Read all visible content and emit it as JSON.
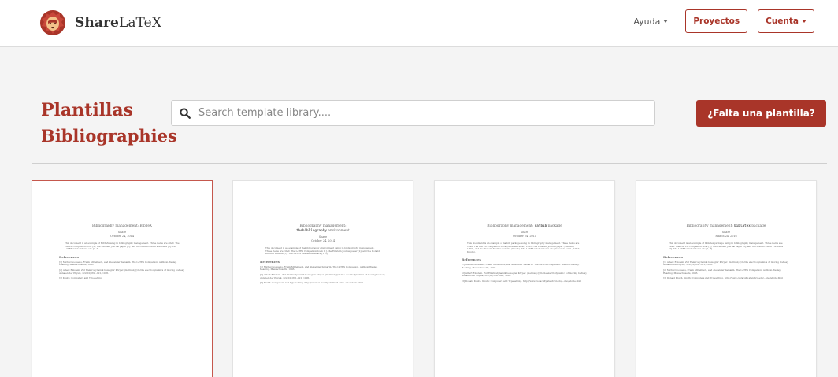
{
  "navbar": {
    "brand_bold": "Share",
    "brand_rest": "LaTeX",
    "help_label": "Ayuda",
    "projects_label": "Proyectos",
    "account_label": "Cuenta",
    "logo_icon": "lion-logo-icon"
  },
  "header": {
    "title": "Plantillas",
    "search_placeholder": "Search template library....",
    "search_icon": "search-icon",
    "missing_button": "¿Falta una plantilla?"
  },
  "section": {
    "title": "Bibliographies"
  },
  "colors": {
    "accent": "#a93529",
    "background": "#f4f4f4"
  },
  "templates": [
    {
      "title_pre": "Bibliography management: BibTeX",
      "title_code": "",
      "title_post": "",
      "author": "Share",
      "date": "October 24, 2014",
      "body": "This document is an example of BibTeX using in bibliography management. Three items are cited: The LATEX Companion book [2], the Einstein journal paper [1], and the Donald Knuth's website [3]. The LATEX related items are [2, 3].",
      "refs_heading": "References",
      "refs": [
        "[1] Michel Goossens, Frank Mittelbach, and Alexander Samarin. The LATEX Companion. Addison-Wesley, Reading, Massachusetts, 1993.",
        "[2] Albert Einstein. Zur Elektrodynamik bewegter Körper. (German) [On the electrodynamics of moving bodies]. Annalen der Physik, 322(10):891–921, 1905.",
        "[3] Knuth: Computers and Typesetting"
      ]
    },
    {
      "title_pre": "Bibliography management:",
      "title_code": "thebibliography",
      "title_post": " environment",
      "author": "Share",
      "date": "October 24, 2014",
      "body": "This document is an example of thebibliography environment using in bibliography management. Three items are cited: The LATEX Companion book [1], the Einstein journal paper [2], and the Donald Knuth's website [3]. The LATEX related items are [1, 3].",
      "refs_heading": "References",
      "refs": [
        "[1] Michel Goossens, Frank Mittelbach, and Alexander Samarin. The LATEX Companion. Addison-Wesley, Reading, Massachusetts, 1993.",
        "[2] Albert Einstein. Zur Elektrodynamik bewegter Körper. (German) [On the electrodynamics of moving bodies]. Annalen der Physik, 322(10):891–921, 1905.",
        "[3] Knuth: Computers and Typesetting, http://www-cs-faculty.stanford.edu/~uno/abcde.html"
      ]
    },
    {
      "title_pre": "Bibliography management:",
      "title_code": "natbib",
      "title_post": " package",
      "author": "Share",
      "date": "October 24, 2014",
      "body": "This document is an example of natbib package using in bibliography management. Three items are cited: The LATEX Companion book (Goossens et al., 1993), the Einstein journal paper (Einstein, 1905), and the Donald Knuth's website (Knuth). The LATEX related items are (Goossens et al., 1993; Knuth).",
      "refs_heading": "References",
      "refs": [
        "[1] Michel Goossens, Frank Mittelbach, and Alexander Samarin. The LATEX Companion. Addison-Wesley, Reading, Massachusetts, 1993.",
        "[2] Albert Einstein. Zur Elektrodynamik bewegter Körper. (German) [On the electrodynamics of moving bodies]. Annalen der Physik, 322(10):891–921, 1905.",
        "[3] Donald Knuth. Knuth: Computers and Typesetting. http://www-cs-faculty.stanford.edu/~uno/abcde.html"
      ]
    },
    {
      "title_pre": "Bibliography management:",
      "title_code": "biblatex",
      "title_post": " package",
      "author": "Share",
      "date": "March 24, 2016",
      "body": "This document is an example of biblatex package using in bibliography management. Three items are cited: The LATEX Companion book [1], the Einstein journal paper [2], and the Donald Knuth's website [3]. The LATEX related items are [1, 3].",
      "refs_heading": "References",
      "refs": [
        "[1] Albert Einstein. Zur Elektrodynamik bewegter Körper. (German) [On the electrodynamics of moving bodies]. Annalen der Physik, 322(10):891–921, 1905.",
        "[2] Michel Goossens, Frank Mittelbach, and Alexander Samarin. The LATEX Companion. Addison-Wesley, Reading, Massachusetts, 1993.",
        "[3] Donald Knuth. Knuth: Computers and Typesetting. http://www-cs-faculty.stanford.edu/~uno/abcde.html"
      ]
    }
  ]
}
